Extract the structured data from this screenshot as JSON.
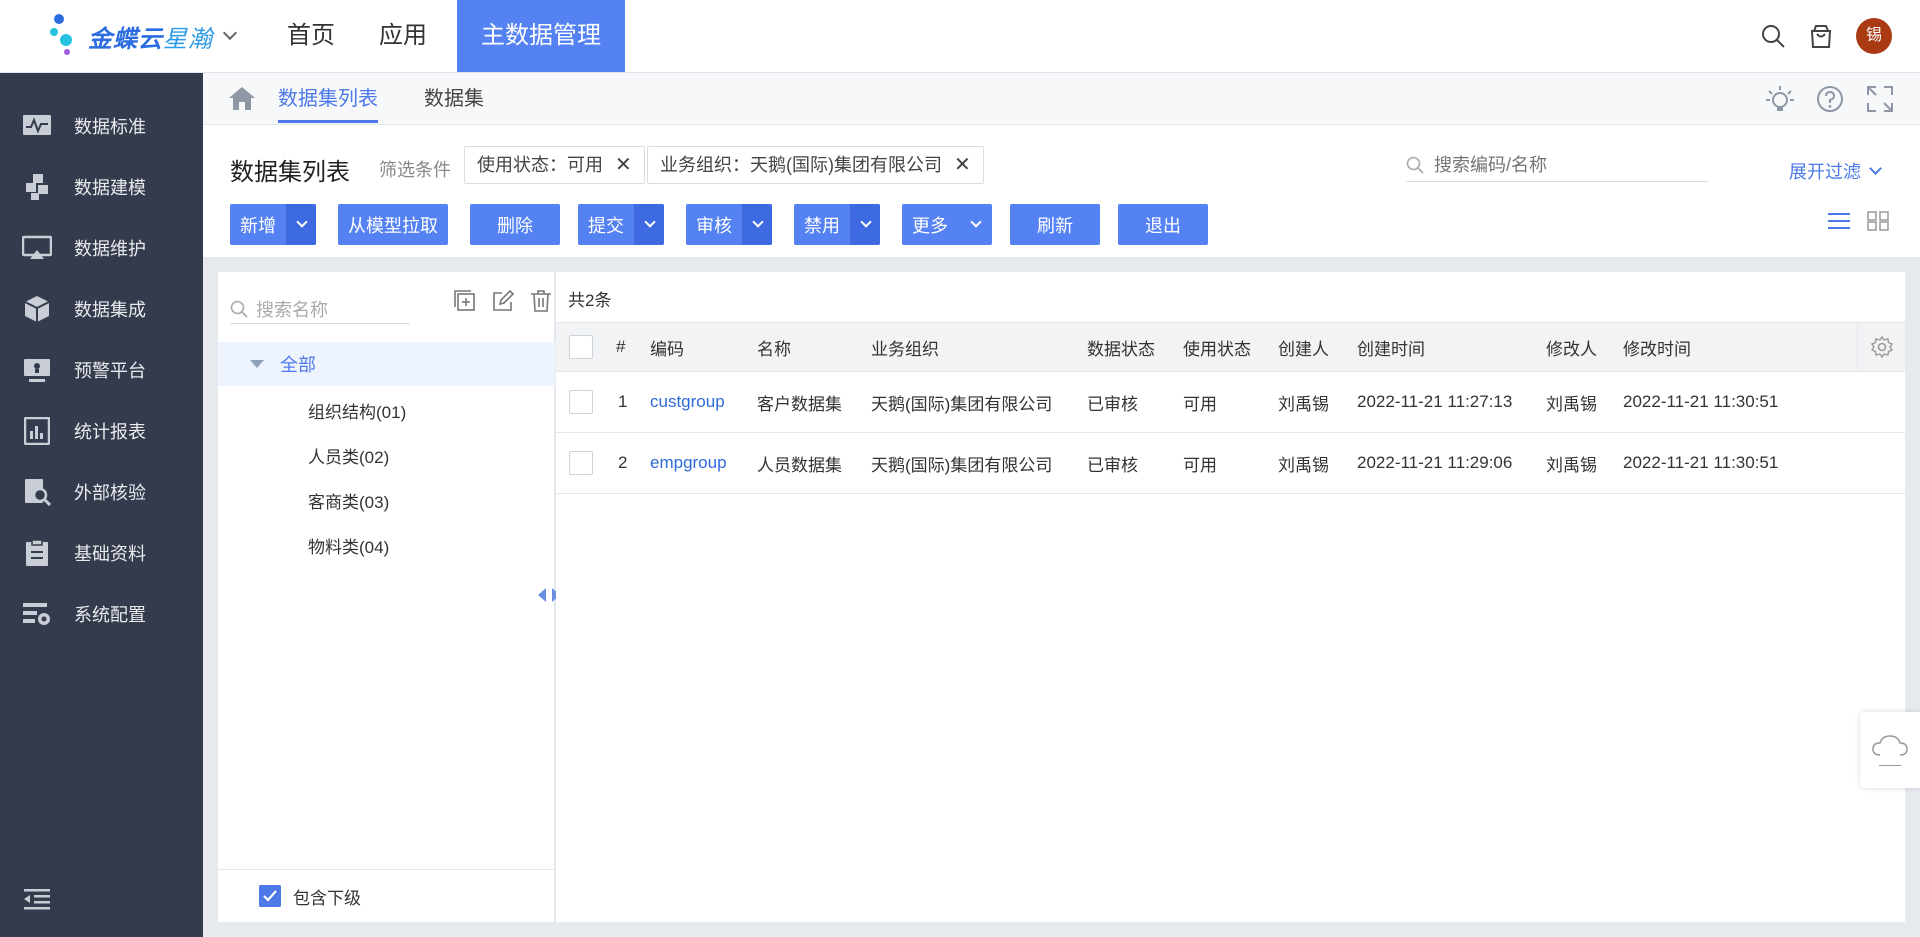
{
  "app": {
    "logo_bold": "金蝶云",
    "logo_light": "星瀚"
  },
  "nav": {
    "items": [
      "首页",
      "应用",
      "主数据管理"
    ],
    "active_index": 2
  },
  "user": {
    "avatar_text": "锡"
  },
  "sidebar": {
    "items": [
      {
        "label": "数据标准",
        "icon": "monitor-wave-icon"
      },
      {
        "label": "数据建模",
        "icon": "blocks-icon"
      },
      {
        "label": "数据维护",
        "icon": "screen-icon"
      },
      {
        "label": "数据集成",
        "icon": "cube-icon"
      },
      {
        "label": "预警平台",
        "icon": "alert-monitor-icon"
      },
      {
        "label": "统计报表",
        "icon": "bar-report-icon"
      },
      {
        "label": "外部核验",
        "icon": "search-doc-icon"
      },
      {
        "label": "基础资料",
        "icon": "clipboard-icon"
      },
      {
        "label": "系统配置",
        "icon": "config-icon"
      }
    ]
  },
  "tabs": {
    "items": [
      "数据集列表",
      "数据集"
    ],
    "active_index": 0
  },
  "toolbar": {
    "page_title": "数据集列表",
    "filter_label": "筛选条件",
    "chips": [
      "使用状态：可用",
      "业务组织：天鹅(国际)集团有限公司"
    ],
    "search_placeholder": "搜索编码/名称",
    "expand_filter": "展开过滤",
    "buttons": {
      "add": "新增",
      "pull_from_model": "从模型拉取",
      "delete": "删除",
      "submit": "提交",
      "audit": "审核",
      "disable": "禁用",
      "more": "更多",
      "refresh": "刷新",
      "exit": "退出"
    }
  },
  "tree": {
    "search_placeholder": "搜索名称",
    "root": "全部",
    "nodes": [
      "组织结构(01)",
      "人员类(02)",
      "客商类(03)",
      "物料类(04)"
    ],
    "include_children": "包含下级",
    "include_children_checked": true
  },
  "grid": {
    "count_text": "共2条",
    "headers": {
      "index": "#",
      "code": "编码",
      "name": "名称",
      "org": "业务组织",
      "data_status": "数据状态",
      "use_status": "使用状态",
      "creator": "创建人",
      "created_at": "创建时间",
      "modifier": "修改人",
      "modified_at": "修改时间"
    },
    "rows": [
      {
        "index": "1",
        "code": "custgroup",
        "name": "客户数据集",
        "org": "天鹅(国际)集团有限公司",
        "data_status": "已审核",
        "use_status": "可用",
        "creator": "刘禹锡",
        "created_at": "2022-11-21 11:27:13",
        "modifier": "刘禹锡",
        "modified_at": "2022-11-21 11:30:51"
      },
      {
        "index": "2",
        "code": "empgroup",
        "name": "人员数据集",
        "org": "天鹅(国际)集团有限公司",
        "data_status": "已审核",
        "use_status": "可用",
        "creator": "刘禹锡",
        "created_at": "2022-11-21 11:29:06",
        "modifier": "刘禹锡",
        "modified_at": "2022-11-21 11:30:51"
      }
    ]
  },
  "colors": {
    "primary": "#5582f3",
    "link": "#2f6ad9",
    "sidebar_bg": "#343b4c",
    "avatar_bg": "#a93a14"
  }
}
